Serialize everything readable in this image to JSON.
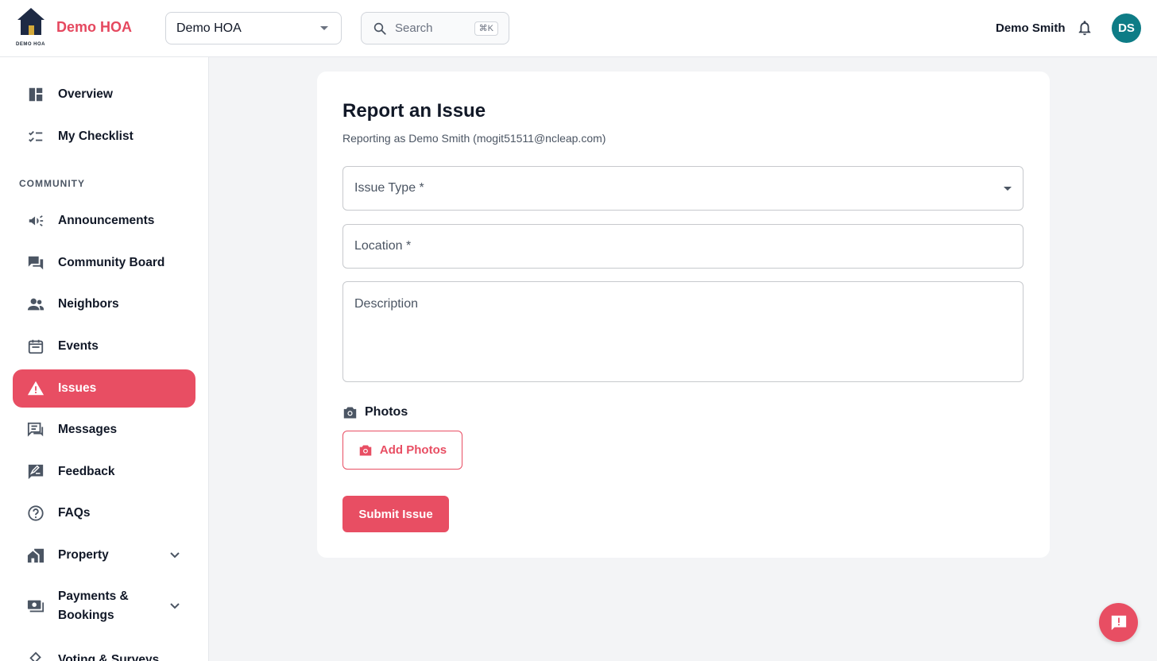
{
  "header": {
    "logo_text": "DEMO HOA",
    "brand": "Demo HOA",
    "org_select": {
      "value": "Demo HOA",
      "icon": "chevron-down-icon"
    },
    "search": {
      "placeholder": "Search",
      "shortcut": "⌘K",
      "icon": "search-icon"
    },
    "user_name": "Demo Smith",
    "bell_icon": "bell-icon",
    "avatar_initials": "DS",
    "avatar_color": "#0e7c86"
  },
  "sidebar": {
    "top_items": [
      {
        "label": "Overview",
        "icon": "dashboard-icon"
      },
      {
        "label": "My Checklist",
        "icon": "checklist-icon"
      }
    ],
    "section_label": "COMMUNITY",
    "items": [
      {
        "label": "Announcements",
        "icon": "megaphone-icon"
      },
      {
        "label": "Community Board",
        "icon": "forum-icon"
      },
      {
        "label": "Neighbors",
        "icon": "people-icon"
      },
      {
        "label": "Events",
        "icon": "calendar-icon"
      },
      {
        "label": "Issues",
        "icon": "warning-icon",
        "active": true
      },
      {
        "label": "Messages",
        "icon": "chat-icon"
      },
      {
        "label": "Feedback",
        "icon": "feedback-icon"
      },
      {
        "label": "FAQs",
        "icon": "help-circle-icon"
      },
      {
        "label": "Property",
        "icon": "home-work-icon",
        "expandable": true
      },
      {
        "label_line1": "Payments &",
        "label_line2": "Bookings",
        "icon": "payments-icon",
        "expandable": true
      },
      {
        "label": "Voting & Surveys",
        "icon": "ballot-icon"
      }
    ]
  },
  "main": {
    "title": "Report an Issue",
    "subtitle": "Reporting as Demo Smith (mogit51511@ncleap.com)",
    "fields": {
      "issue_type": "Issue Type *",
      "location": "Location *",
      "description": "Description"
    },
    "photos_label": "Photos",
    "add_photos_label": "Add Photos",
    "submit_label": "Submit Issue"
  },
  "colors": {
    "accent": "#e84e63",
    "brand": "#e5485f",
    "navy": "#1e2a44"
  },
  "fab_icon": "feedback-alert-icon"
}
